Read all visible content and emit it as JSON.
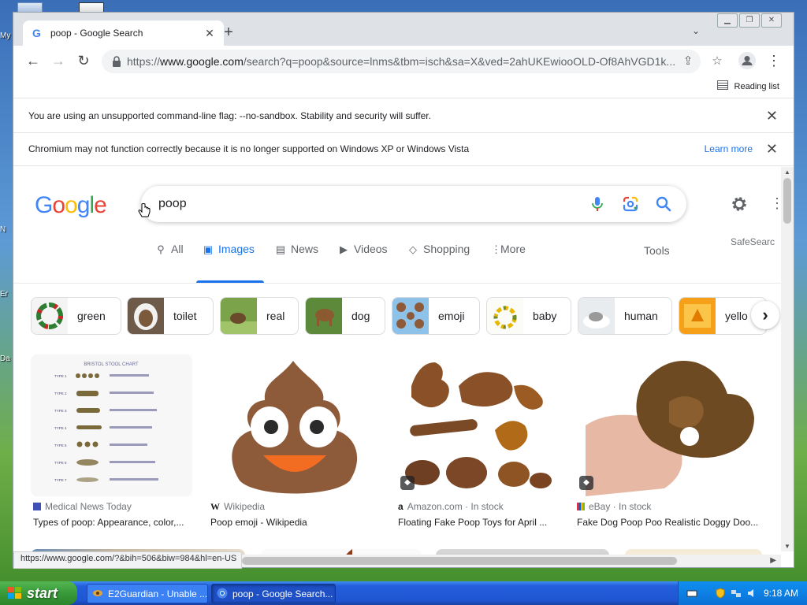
{
  "desktop": {
    "labels": [
      "My",
      "N",
      "Er",
      "Da"
    ]
  },
  "browser": {
    "tab": {
      "title": "poop - Google Search"
    },
    "url": {
      "scheme": "https://",
      "host": "www.google.com",
      "path": "/search?q=poop&source=lnms&tbm=isch&sa=X&ved=2ahUKEwiooOLD-Of8AhVGD1k..."
    },
    "reading_list_label": "Reading list",
    "infobars": [
      {
        "text": "You are using an unsupported command-line flag: --no-sandbox. Stability and security will suffer.",
        "action": ""
      },
      {
        "text": "Chromium may not function correctly because it is no longer supported on Windows XP or Windows Vista",
        "action": "Learn more"
      }
    ],
    "status_url": "https://www.google.com/?&bih=506&biw=984&hl=en-US"
  },
  "google": {
    "logo_letters": [
      "G",
      "o",
      "o",
      "g",
      "l",
      "e"
    ],
    "logo_colors": [
      "#4285f4",
      "#ea4335",
      "#fbbc05",
      "#4285f4",
      "#34a853",
      "#ea4335"
    ],
    "query": "poop",
    "tabs": [
      {
        "label": "All",
        "icon": "search-icon"
      },
      {
        "label": "Images",
        "icon": "image-icon",
        "active": true
      },
      {
        "label": "News",
        "icon": "news-icon"
      },
      {
        "label": "Videos",
        "icon": "play-icon"
      },
      {
        "label": "Shopping",
        "icon": "tag-icon"
      },
      {
        "label": "More",
        "icon": "more-vertical-icon"
      }
    ],
    "tools_label": "Tools",
    "safesearch_label": "SafeSearc",
    "chips": [
      "green",
      "toilet",
      "real",
      "dog",
      "emoji",
      "baby",
      "human",
      "yello"
    ],
    "results": [
      {
        "source": "Medical News Today",
        "title": "Types of poop: Appearance, color,..."
      },
      {
        "source": "Wikipedia",
        "title": "Poop emoji - Wikipedia"
      },
      {
        "source": "Amazon.com · In stock",
        "title": "Floating Fake Poop Toys for April ..."
      },
      {
        "source": "eBay · In stock",
        "title": "Fake Dog Poop Poo Realistic Doggy Doo..."
      }
    ],
    "chart_labels": {
      "heading": "BRISTOL STOOL CHART",
      "types": [
        "TYPE 1",
        "TYPE 2",
        "TYPE 3",
        "TYPE 4",
        "TYPE 5",
        "TYPE 6",
        "TYPE 7"
      ]
    }
  },
  "taskbar": {
    "start_label": "start",
    "tasks": [
      "E2Guardian - Unable ...",
      "poop - Google Search..."
    ],
    "clock": "9:18 AM"
  },
  "colors": {
    "accent": "#1a73e8",
    "poop_brown": "#8d5a3a",
    "emoji_mouth": "#f26d21"
  }
}
